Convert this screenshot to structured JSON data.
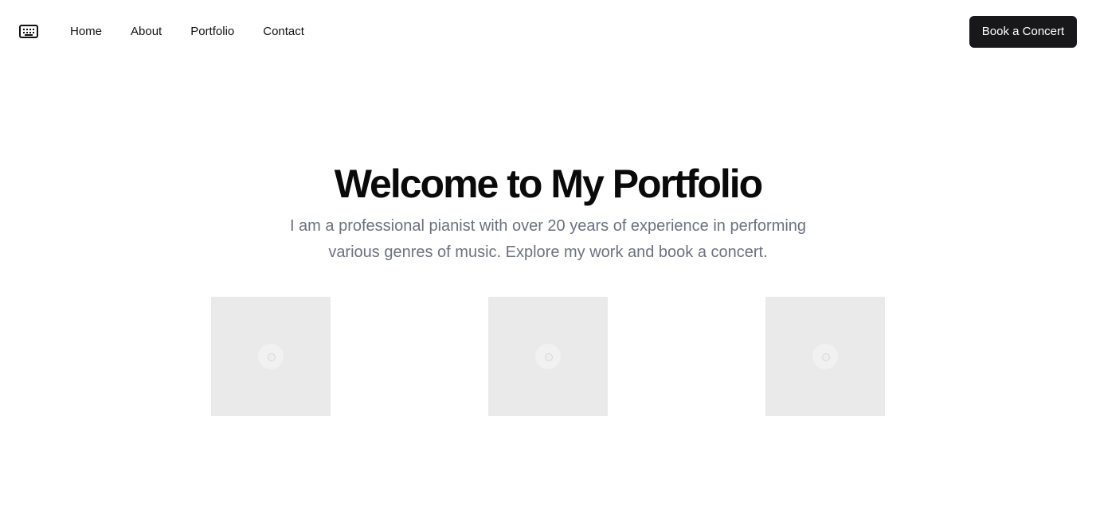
{
  "header": {
    "logo_icon": "keyboard-icon",
    "nav": [
      {
        "label": "Home"
      },
      {
        "label": "About"
      },
      {
        "label": "Portfolio"
      },
      {
        "label": "Contact"
      }
    ],
    "cta_label": "Book a Concert"
  },
  "hero": {
    "title": "Welcome to My Portfolio",
    "subtitle": "I am a professional pianist with over 20 years of experience in performing various genres of music. Explore my work and book a concert."
  },
  "gallery": {
    "items": [
      {
        "icon": "image-placeholder-icon"
      },
      {
        "icon": "image-placeholder-icon"
      },
      {
        "icon": "image-placeholder-icon"
      }
    ]
  },
  "colors": {
    "button_bg": "#18181b",
    "subtitle_text": "#6b7280",
    "placeholder_bg": "#eaeaea"
  }
}
